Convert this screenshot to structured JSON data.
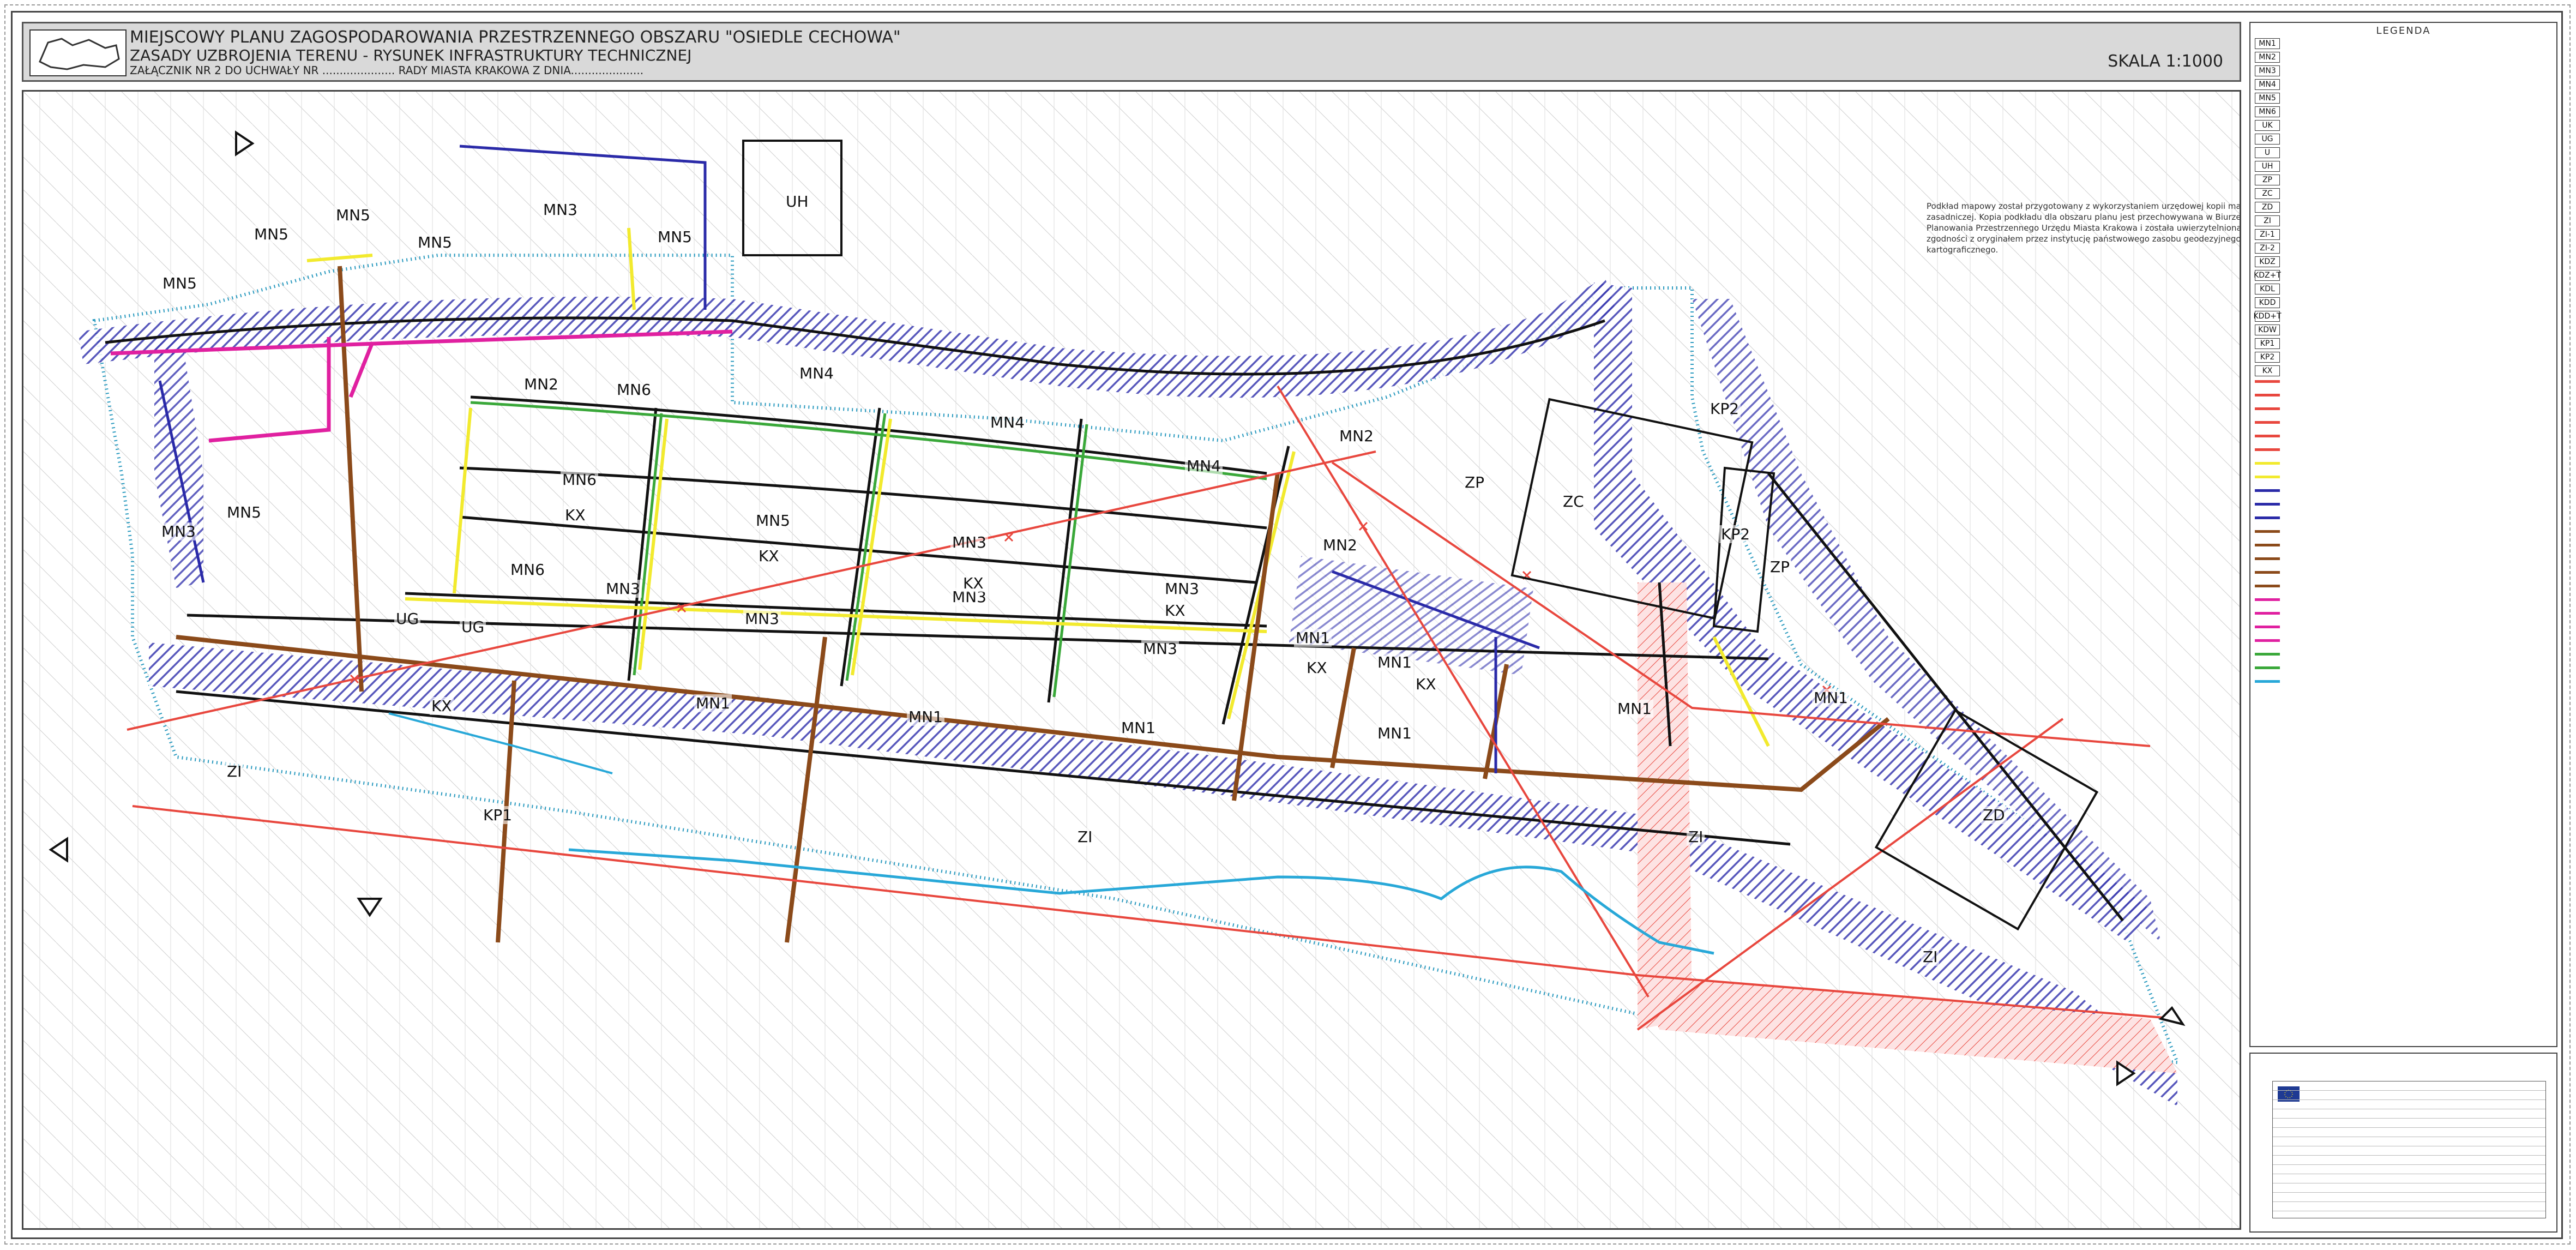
{
  "header": {
    "title_line1": "MIEJSCOWY PLANU ZAGOSPODAROWANIA PRZESTRZENNEGO OBSZARU \"OSIEDLE CECHOWA\"",
    "title_line2": "ZASADY UZBROJENIA TERENU - RYSUNEK INFRASTRUKTURY TECHNICZNEJ",
    "title_line3": "ZAŁĄCZNIK NR 2 DO UCHWAŁY NR ..................... RADY MIASTA KRAKOWA Z DNIA.....................",
    "scale": "SKALA 1:1000"
  },
  "note_text": "Podkład mapowy został przygotowany z wykorzystaniem urzędowej kopii mapy zasadniczej. Kopia podkładu dla obszaru planu jest przechowywana w Biurze Planowania Przestrzennego Urzędu Miasta Krakowa i została uwierzytelniona zgodności z oryginałem przez instytucję państwowego zasobu geodezyjnego i kartograficznego.",
  "zones": [
    {
      "label": "MN5"
    },
    {
      "label": "MN5"
    },
    {
      "label": "MN5"
    },
    {
      "label": "MN5"
    },
    {
      "label": "MN3"
    },
    {
      "label": "UH"
    },
    {
      "label": "MN5"
    },
    {
      "label": "MN3"
    },
    {
      "label": "MN5"
    },
    {
      "label": "MN2"
    },
    {
      "label": "MN6"
    },
    {
      "label": "MN4"
    },
    {
      "label": "MN4"
    },
    {
      "label": "MN4"
    },
    {
      "label": "MN6"
    },
    {
      "label": "MN5"
    },
    {
      "label": "MN3"
    },
    {
      "label": "MN6"
    },
    {
      "label": "MN3"
    },
    {
      "label": "MN3"
    },
    {
      "label": "MN3"
    },
    {
      "label": "MN3"
    },
    {
      "label": "MN3"
    },
    {
      "label": "MN3"
    },
    {
      "label": "MN2"
    },
    {
      "label": "MN2"
    },
    {
      "label": "MN1"
    },
    {
      "label": "MN1"
    },
    {
      "label": "MN1"
    },
    {
      "label": "MN1"
    },
    {
      "label": "MN1"
    },
    {
      "label": "MN1"
    },
    {
      "label": "MN1"
    },
    {
      "label": "MN1"
    },
    {
      "label": "UG"
    },
    {
      "label": "UG"
    },
    {
      "label": "KX"
    },
    {
      "label": "KX"
    },
    {
      "label": "KX"
    },
    {
      "label": "KX"
    },
    {
      "label": "KX"
    },
    {
      "label": "KX"
    },
    {
      "label": "ZP"
    },
    {
      "label": "ZC"
    },
    {
      "label": "ZP"
    },
    {
      "label": "KP2"
    },
    {
      "label": "KP2"
    },
    {
      "label": "ZD"
    },
    {
      "label": "ZI"
    },
    {
      "label": "ZI"
    },
    {
      "label": "ZI"
    },
    {
      "label": "ZI"
    },
    {
      "label": "KP1"
    },
    {
      "label": "KX"
    }
  ],
  "legend": {
    "title": "LEGENDA",
    "symbols": [
      {
        "code": "MN1",
        "color": "#ffffff"
      },
      {
        "code": "MN2",
        "color": "#ffffff"
      },
      {
        "code": "MN3",
        "color": "#ffffff"
      },
      {
        "code": "MN4",
        "color": "#ffffff"
      },
      {
        "code": "MN5",
        "color": "#ffffff"
      },
      {
        "code": "MN6",
        "color": "#ffffff"
      },
      {
        "code": "UK",
        "color": "#ffffff"
      },
      {
        "code": "UG",
        "color": "#ffffff"
      },
      {
        "code": "U",
        "color": "#ffffff"
      },
      {
        "code": "UH",
        "color": "#ffffff"
      },
      {
        "code": "ZP",
        "color": "#ffffff"
      },
      {
        "code": "ZC",
        "color": "#ffffff"
      },
      {
        "code": "ZD",
        "color": "#ffffff"
      },
      {
        "code": "ZI",
        "color": "#ffffff"
      },
      {
        "code": "ZI-1",
        "color": "#ffffff"
      },
      {
        "code": "ZI-2",
        "color": "#ffffff"
      },
      {
        "code": "KDZ",
        "color": "#ffffff"
      },
      {
        "code": "KDZ+T",
        "color": "#ffffff"
      },
      {
        "code": "KDL",
        "color": "#ffffff"
      },
      {
        "code": "KDD",
        "color": "#ffffff"
      },
      {
        "code": "KDD+T",
        "color": "#ffffff"
      },
      {
        "code": "KDW",
        "color": "#ffffff"
      },
      {
        "code": "KP1",
        "color": "#ffffff"
      },
      {
        "code": "KP2",
        "color": "#ffffff"
      },
      {
        "code": "KX",
        "color": "#ffffff"
      }
    ],
    "lines": [
      {
        "color": "#e8473e"
      },
      {
        "color": "#e8473e"
      },
      {
        "color": "#e8473e"
      },
      {
        "color": "#e8473e"
      },
      {
        "color": "#e8473e"
      },
      {
        "color": "#e8473e"
      },
      {
        "color": "#f2ea2e"
      },
      {
        "color": "#f2ea2e"
      },
      {
        "color": "#2a2aa8"
      },
      {
        "color": "#2a2aa8"
      },
      {
        "color": "#2a2aa8"
      },
      {
        "color": "#8b4a1a"
      },
      {
        "color": "#8b4a1a"
      },
      {
        "color": "#8b4a1a"
      },
      {
        "color": "#8b4a1a"
      },
      {
        "color": "#8b4a1a"
      },
      {
        "color": "#e020a0"
      },
      {
        "color": "#e020a0"
      },
      {
        "color": "#e020a0"
      },
      {
        "color": "#e020a0"
      },
      {
        "color": "#3aa83a"
      },
      {
        "color": "#3aa83a"
      },
      {
        "color": "#28a8d8"
      }
    ]
  },
  "colors": {
    "electric": "#e8473e",
    "gas": "#f2ea2e",
    "water": "#2a2aa8",
    "sewer": "#8b4a1a",
    "heat": "#e020a0",
    "telecom": "#3aa83a",
    "stream": "#28a8d8",
    "boundary": "#2a9abf"
  }
}
